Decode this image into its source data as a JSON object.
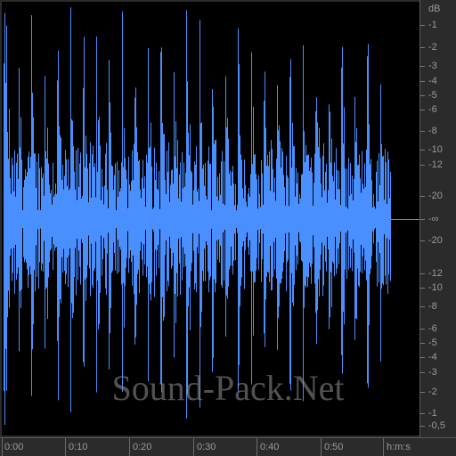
{
  "colors": {
    "waveform": "#4a8fff",
    "background": "#000000",
    "ruler_bg": "#2b2b2b",
    "ruler_text": "#9a9a9a"
  },
  "db_scale": {
    "unit": "dB",
    "top_labels": [
      "-1",
      "-2",
      "-3",
      "-4",
      "-5",
      "-6",
      "-8",
      "-10",
      "-12",
      "-20"
    ],
    "center_label": "-∞",
    "bottom_labels": [
      "-20",
      "-12",
      "-10",
      "-8",
      "-6",
      "-5",
      "-4",
      "-3",
      "-2",
      "-1",
      "-0,5"
    ]
  },
  "time_scale": {
    "labels": [
      "0:00",
      "0:10",
      "0:20",
      "0:30",
      "0:40",
      "0:50"
    ],
    "unit": "h:m:s"
  },
  "watermark": "Sound-Pack.Net"
}
